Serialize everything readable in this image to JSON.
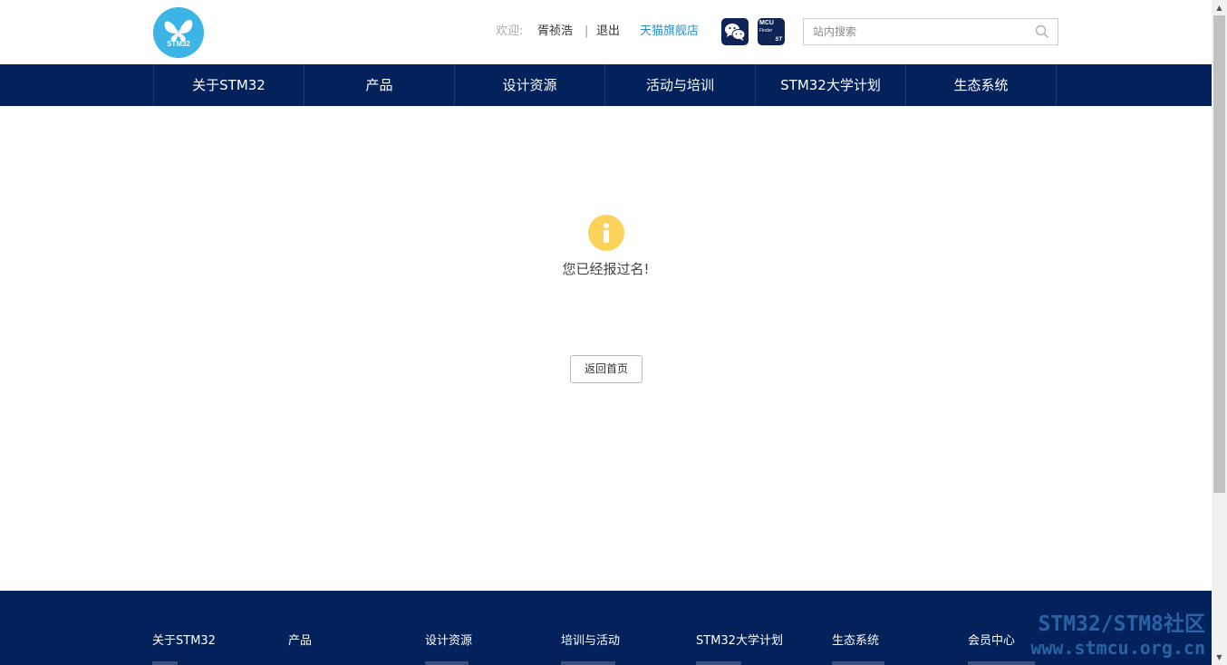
{
  "header": {
    "logo_text": "STM32",
    "welcome_label": "欢迎:",
    "username": "胥祯浩",
    "separator": "|",
    "logout": "退出",
    "tmall_store": "天猫旗舰店",
    "wechat_icon": "wechat-icon",
    "mcu_finder": {
      "line1": "MCU",
      "line2": "Finder",
      "brand": "ST"
    },
    "search": {
      "placeholder": "站内搜索",
      "icon": "search-icon"
    }
  },
  "nav": {
    "items": [
      {
        "label": "关于STM32"
      },
      {
        "label": "产品"
      },
      {
        "label": "设计资源"
      },
      {
        "label": "活动与培训"
      },
      {
        "label": "STM32大学计划"
      },
      {
        "label": "生态系统"
      }
    ]
  },
  "main": {
    "icon": "info-icon",
    "message": "您已经报过名!",
    "back_button": "返回首页"
  },
  "footer": {
    "columns": [
      {
        "title": "关于STM32"
      },
      {
        "title": "产品"
      },
      {
        "title": "设计资源"
      },
      {
        "title": "培训与活动"
      },
      {
        "title": "STM32大学计划"
      },
      {
        "title": "生态系统"
      },
      {
        "title": "会员中心"
      }
    ]
  },
  "watermark": {
    "line1": "STM32/STM8社区",
    "line2": "www.stmcu.org.cn"
  },
  "colors": {
    "nav_bg": "#03215a",
    "logo_bg": "#3cb4e5",
    "info_icon": "#fbd35b",
    "link_blue": "#2d8cc8"
  }
}
